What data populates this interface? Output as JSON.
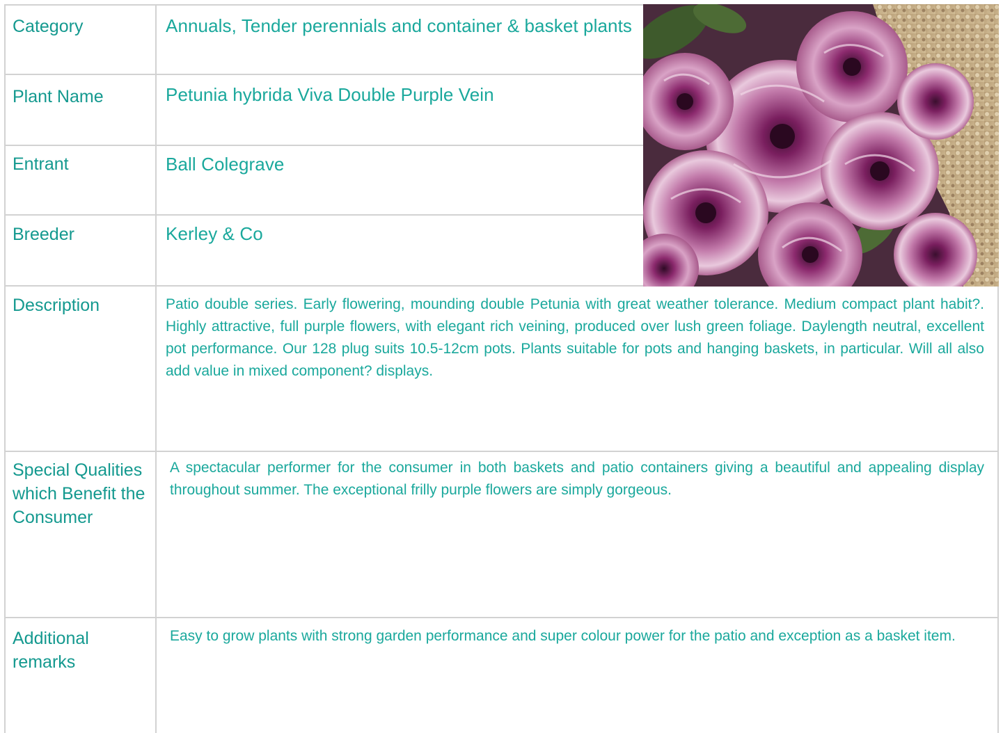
{
  "rows": {
    "category": {
      "label": "Category",
      "value": "Annuals, Tender perennials and container & basket plants"
    },
    "plant_name": {
      "label": "Plant Name",
      "value": "Petunia hybrida Viva Double Purple Vein"
    },
    "entrant": {
      "label": "Entrant",
      "value": "Ball Colegrave"
    },
    "breeder": {
      "label": "Breeder",
      "value": "Kerley & Co"
    },
    "description": {
      "label": "Description",
      "value": "Patio double series. Early flowering, mounding double Petunia with great weather tolerance. Medium compact plant habit?. Highly attractive, full purple flowers, with elegant rich veining, produced over lush green foliage. Daylength neutral, excellent pot performance. Our 128 plug suits 10.5-12cm pots. Plants suitable for pots and hanging baskets, in particular. Will all also add value in mixed component? displays."
    },
    "special_qualities": {
      "label": "Special Qualities which Benefit the Consumer",
      "value": "A spectacular performer for the consumer in both baskets and patio containers giving a beautiful and appealing display throughout summer. The exceptional frilly purple flowers are simply gorgeous."
    },
    "additional_remarks": {
      "label": "Additional remarks",
      "value": "Easy to grow plants with strong garden performance and super colour power for the patio and exception as a basket item."
    }
  },
  "colors": {
    "label_text": "#14998f",
    "value_text": "#1aa89c",
    "grid_line": "#d2d2d2"
  }
}
